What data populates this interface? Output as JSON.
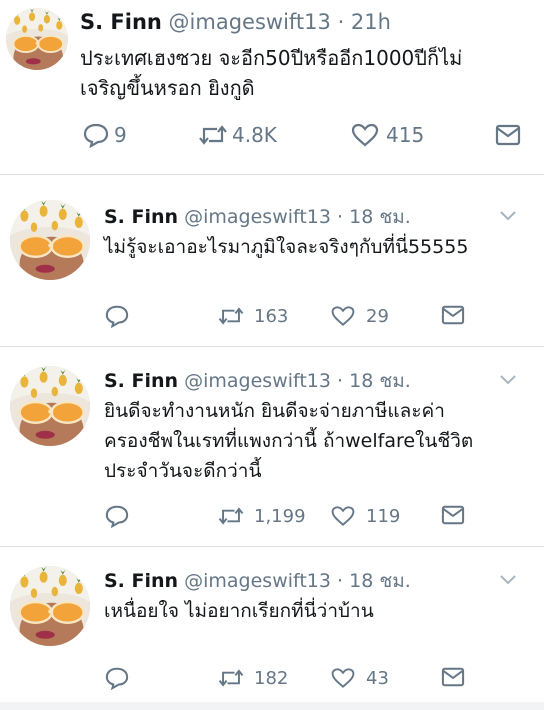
{
  "tweets": [
    {
      "name": "S. Finn",
      "handle": "@imageswift13",
      "time": "· 21h",
      "text_lines": [
        "ประเทศเฮงซวย จะอีก50ปีหรืออีก1000ปีก็ไม่",
        "เจริญขึ้นหรอก ยิงกูดิ"
      ],
      "replies": "9",
      "retweets": "4.8K",
      "likes": "415"
    },
    {
      "name": "S. Finn",
      "handle": "@imageswift13",
      "time": "· 18 ชม.",
      "text_lines": [
        "ไม่รู้จะเอาอะไรมาภูมิใจละจริงๆกับที่นี่55555"
      ],
      "replies": "",
      "retweets": "163",
      "likes": "29"
    },
    {
      "name": "S. Finn",
      "handle": "@imageswift13",
      "time": "· 18 ชม.",
      "text_lines": [
        "ยินดีจะทำงานหนัก ยินดีจะจ่ายภาษีและค่า",
        "ครองชีพในเรทที่แพงกว่านี้ ถ้าwelfareในชีวิต",
        "ประจำวันจะดีกว่านี้"
      ],
      "replies": "",
      "retweets": "1,199",
      "likes": "119"
    },
    {
      "name": "S. Finn",
      "handle": "@imageswift13",
      "time": "· 18 ชม.",
      "text_lines": [
        "เหนื่อยใจ ไม่อยากเรียกที่นี่ว่าบ้าน"
      ],
      "replies": "",
      "retweets": "182",
      "likes": "43"
    }
  ],
  "icons": {
    "reply": "reply-icon",
    "retweet": "retweet-icon",
    "like": "like-icon",
    "message": "message-icon",
    "caret": "chevron-down-icon",
    "expand": "expand-icon"
  },
  "colors": {
    "text": "#14171a",
    "secondary": "#657786",
    "separator": "#dde3e8"
  }
}
